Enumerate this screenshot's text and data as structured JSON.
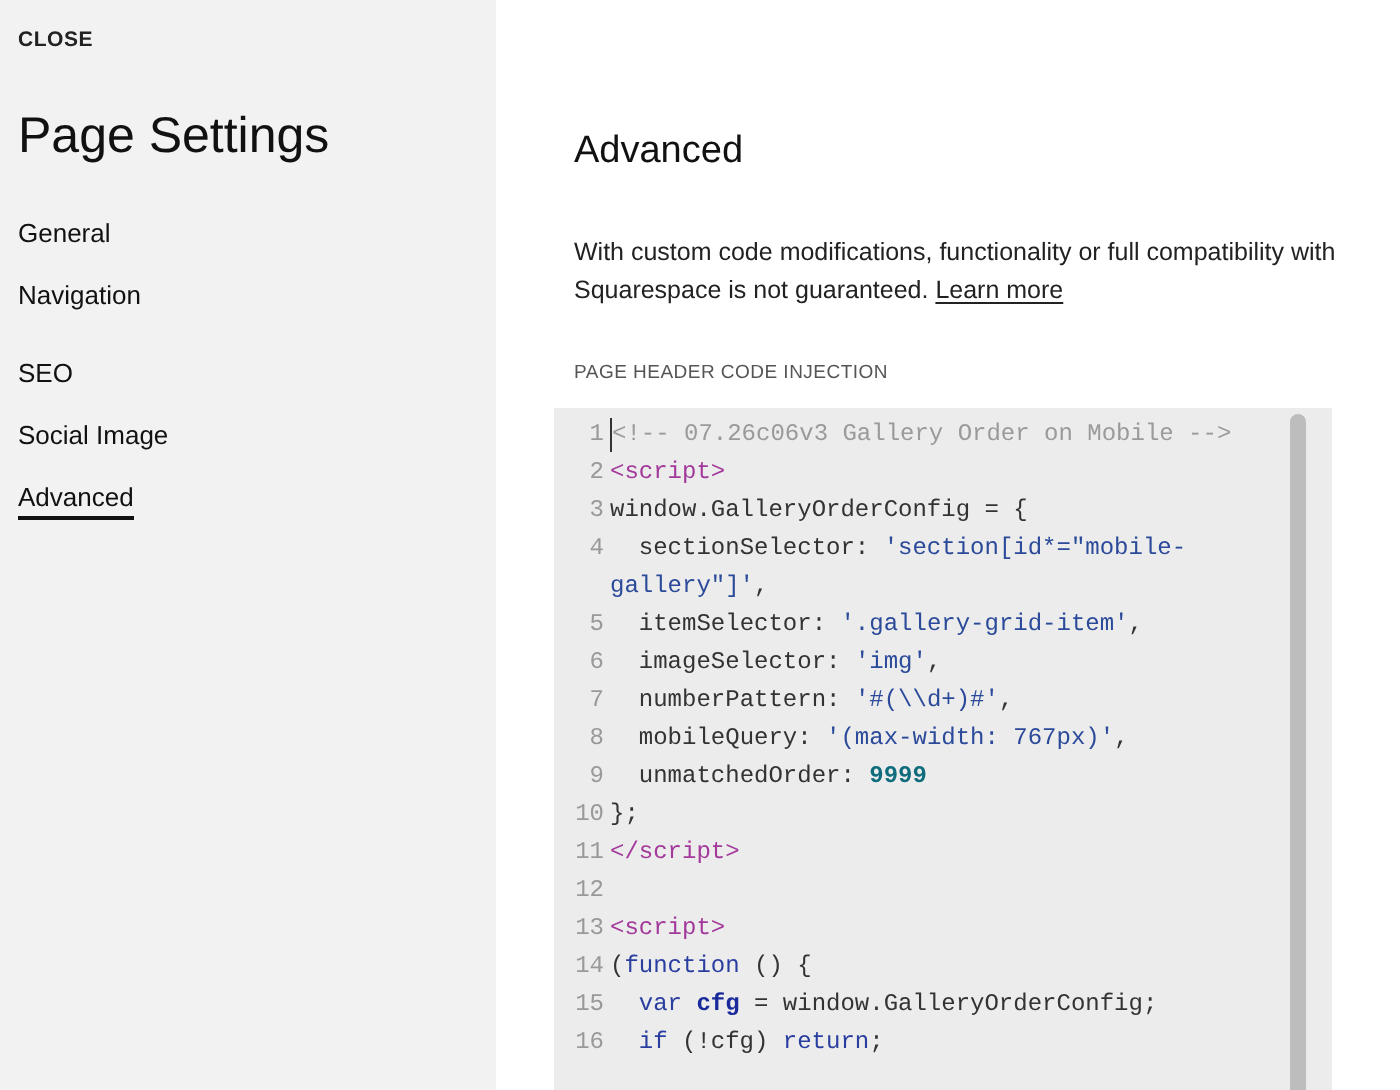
{
  "sidebar": {
    "close": "CLOSE",
    "title": "Page Settings",
    "groups": [
      {
        "items": [
          {
            "label": "General",
            "selected": false
          },
          {
            "label": "Navigation",
            "selected": false
          }
        ]
      },
      {
        "items": [
          {
            "label": "SEO",
            "selected": false
          },
          {
            "label": "Social Image",
            "selected": false
          },
          {
            "label": "Advanced",
            "selected": true
          }
        ]
      }
    ]
  },
  "main": {
    "title": "Advanced",
    "description": "With custom code modifications, functionality or full compatibility with Squarespace is not guaranteed.",
    "link": "Learn more",
    "section_label": "PAGE HEADER CODE INJECTION",
    "code": {
      "lines": [
        {
          "number": "1",
          "tokens": [
            {
              "kind": "comment",
              "text": "<!-- 07.26c06v3 Gallery Order on Mobile -->"
            }
          ]
        },
        {
          "number": "2",
          "tokens": [
            {
              "kind": "tag",
              "text": "<script>"
            }
          ]
        },
        {
          "number": "3",
          "tokens": [
            {
              "kind": "plain",
              "text": "window.GalleryOrderConfig = {"
            }
          ]
        },
        {
          "number": "4",
          "tokens": [
            {
              "kind": "plain",
              "text": "  sectionSelector: "
            },
            {
              "kind": "string",
              "text": "'section[id*=\"mobile-gallery\"]'"
            },
            {
              "kind": "plain",
              "text": ","
            }
          ]
        },
        {
          "number": "5",
          "tokens": [
            {
              "kind": "plain",
              "text": "  itemSelector: "
            },
            {
              "kind": "string",
              "text": "'.gallery-grid-item'"
            },
            {
              "kind": "plain",
              "text": ","
            }
          ]
        },
        {
          "number": "6",
          "tokens": [
            {
              "kind": "plain",
              "text": "  imageSelector: "
            },
            {
              "kind": "string",
              "text": "'img'"
            },
            {
              "kind": "plain",
              "text": ","
            }
          ]
        },
        {
          "number": "7",
          "tokens": [
            {
              "kind": "plain",
              "text": "  numberPattern: "
            },
            {
              "kind": "string",
              "text": "'#(\\\\d+)#'"
            },
            {
              "kind": "plain",
              "text": ","
            }
          ]
        },
        {
          "number": "8",
          "tokens": [
            {
              "kind": "plain",
              "text": "  mobileQuery: "
            },
            {
              "kind": "string",
              "text": "'(max-width: 767px)'"
            },
            {
              "kind": "plain",
              "text": ","
            }
          ]
        },
        {
          "number": "9",
          "tokens": [
            {
              "kind": "plain",
              "text": "  unmatchedOrder: "
            },
            {
              "kind": "number",
              "text": "9999"
            }
          ]
        },
        {
          "number": "10",
          "tokens": [
            {
              "kind": "plain",
              "text": "};"
            }
          ]
        },
        {
          "number": "11",
          "tokens": [
            {
              "kind": "tag",
              "text": "</script>"
            }
          ]
        },
        {
          "number": "12"
        },
        {
          "number": "13",
          "tokens": [
            {
              "kind": "tag",
              "text": "<script>"
            }
          ]
        },
        {
          "number": "14",
          "tokens": [
            {
              "kind": "plain",
              "text": "("
            },
            {
              "kind": "keyword",
              "text": "function"
            },
            {
              "kind": "plain",
              "text": " () {"
            }
          ]
        },
        {
          "number": "15",
          "indented": true,
          "tokens": [
            {
              "kind": "keyword",
              "text": "var "
            },
            {
              "kind": "variable",
              "text": "cfg"
            },
            {
              "kind": "plain",
              "text": " = window.GalleryOrderConfig;"
            }
          ]
        },
        {
          "number": "16",
          "indented": true,
          "tokens": [
            {
              "kind": "keyword",
              "text": "if"
            },
            {
              "kind": "plain",
              "text": " (!cfg) "
            },
            {
              "kind": "keyword",
              "text": "return"
            },
            {
              "kind": "plain",
              "text": ";"
            }
          ]
        }
      ]
    }
  }
}
